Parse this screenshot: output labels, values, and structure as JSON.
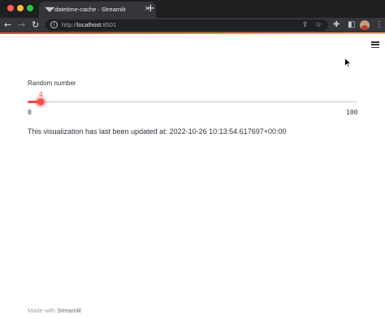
{
  "browser": {
    "tab": {
      "title": "datetime-cache · Streamlit",
      "favicon_icon": "streamlit-favicon-icon"
    },
    "new_tab_label": "+",
    "address": {
      "scheme": "http://",
      "host": "localhost",
      "port": ":8501"
    },
    "icons": [
      "back-icon",
      "forward-icon",
      "reload-icon",
      "info-icon",
      "share-icon",
      "star-icon",
      "extensions-icon",
      "sidebar-icon",
      "profile-avatar",
      "more-icon"
    ]
  },
  "app": {
    "accent_color": "#ff4b4b",
    "slider": {
      "label": "Random number",
      "value": 4,
      "value_text": "4",
      "min": 0,
      "max": 100,
      "min_text": "0",
      "max_text": "100"
    },
    "status_text": "This visualization has last been updated at: 2022-10-26 10:13:54.617697+00:00",
    "footer": {
      "prefix": "Made with ",
      "brand": "Streamlit"
    }
  }
}
